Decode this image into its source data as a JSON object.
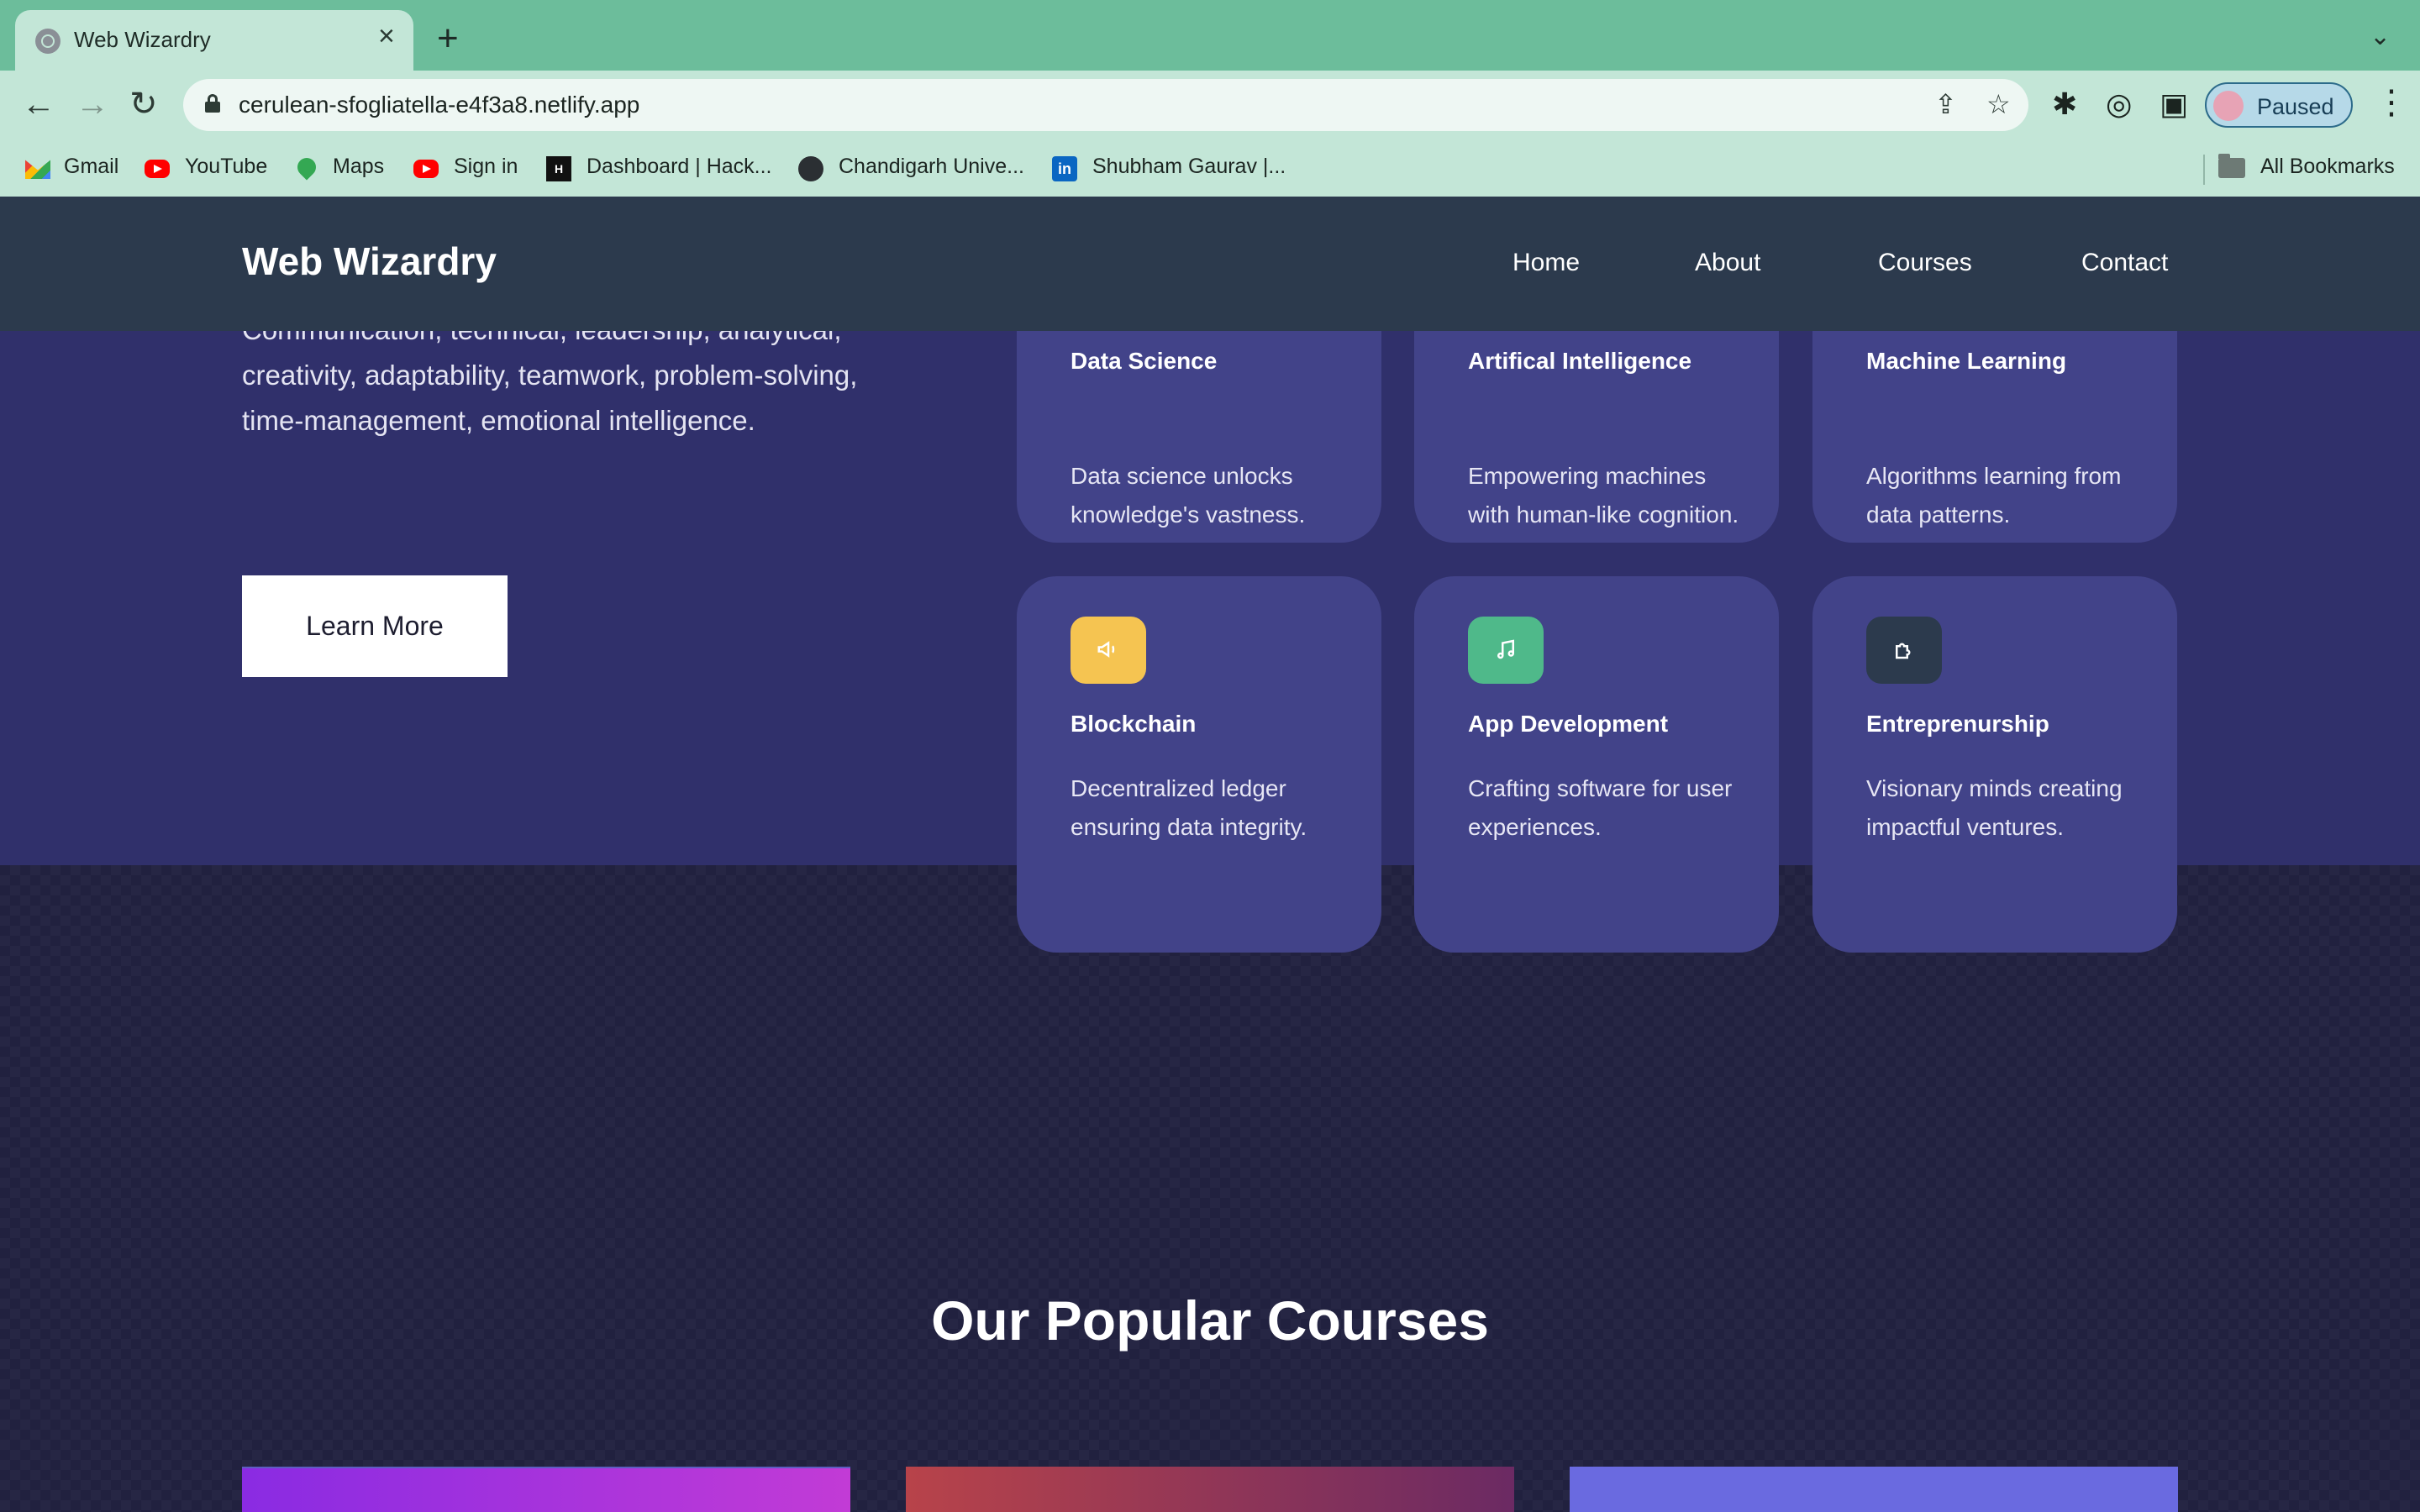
{
  "browser": {
    "tab_title": "Web Wizardry",
    "url": "cerulean-sfogliatella-e4f3a8.netlify.app",
    "profile_status": "Paused",
    "bookmarks": [
      {
        "label": "Gmail",
        "icon": "gmail-icon"
      },
      {
        "label": "YouTube",
        "icon": "youtube-icon"
      },
      {
        "label": "Maps",
        "icon": "maps-icon"
      },
      {
        "label": "Sign in",
        "icon": "youtube-icon"
      },
      {
        "label": "Dashboard | Hack...",
        "icon": "hackerrank-icon"
      },
      {
        "label": "Chandigarh Unive...",
        "icon": "globe-icon"
      },
      {
        "label": "Shubham Gaurav |...",
        "icon": "linkedin-icon"
      }
    ],
    "all_bookmarks": "All Bookmarks"
  },
  "site": {
    "brand": "Web Wizardry",
    "nav": {
      "home": "Home",
      "about": "About",
      "courses": "Courses",
      "contact": "Contact"
    },
    "hero_text": "Communication, technical, leadership, analytical, creativity, adaptability, teamwork, problem-solving, time-management, emotional intelligence.",
    "learn_more": "Learn More",
    "cards": [
      {
        "title": "Data Science",
        "desc": "Data science unlocks knowledge's vastness."
      },
      {
        "title": "Artifical Intelligence",
        "desc": "Empowering machines with human-like cognition."
      },
      {
        "title": "Machine Learning",
        "desc": "Algorithms learning from data patterns."
      },
      {
        "title": "Blockchain",
        "desc": "Decentralized ledger ensuring data integrity.",
        "icon": "megaphone-icon",
        "icon_color": "#f5c451"
      },
      {
        "title": "App Development",
        "desc": "Crafting software for user experiences.",
        "icon": "music-note-icon",
        "icon_color": "#4fb98a"
      },
      {
        "title": "Entreprenurship",
        "desc": "Visionary minds creating impactful ventures.",
        "icon": "puzzle-icon",
        "icon_color": "#2c3a4d"
      }
    ],
    "section_title": "Our Popular Courses"
  },
  "colors": {
    "tab_strip": "#6cbd9b",
    "toolbar": "#c3e6d7",
    "navbar": "#2c3a4d",
    "hero_bg": "#30306b",
    "card_bg": "#424389",
    "dark_bg": "#21213f"
  }
}
